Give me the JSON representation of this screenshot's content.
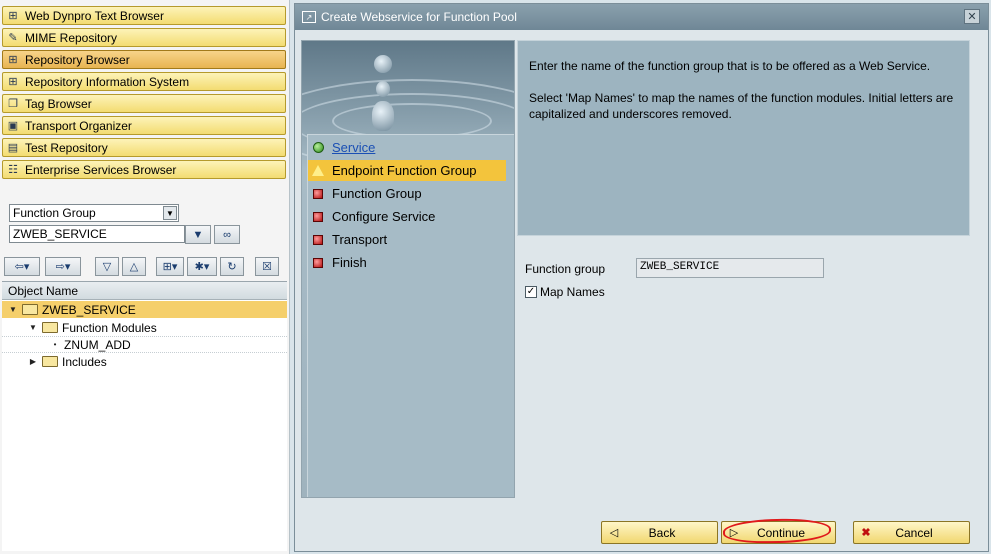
{
  "nav_buttons": [
    {
      "label": "Web Dynpro Text Browser",
      "icon": "hierarchy-icon",
      "active": false
    },
    {
      "label": "MIME Repository",
      "icon": "edit-icon",
      "active": false
    },
    {
      "label": "Repository Browser",
      "icon": "hierarchy-icon",
      "active": true
    },
    {
      "label": "Repository Information System",
      "icon": "hierarchy-icon",
      "active": false
    },
    {
      "label": "Tag Browser",
      "icon": "tag-icon",
      "active": false
    },
    {
      "label": "Transport Organizer",
      "icon": "truck-icon",
      "active": false
    },
    {
      "label": "Test Repository",
      "icon": "test-icon",
      "active": false
    },
    {
      "label": "Enterprise Services Browser",
      "icon": "services-icon",
      "active": false
    }
  ],
  "object_type_select": {
    "value": "Function Group"
  },
  "object_name_input": {
    "value": "ZWEB_SERVICE"
  },
  "tree": {
    "header": "Object Name",
    "rows": [
      {
        "label": "ZWEB_SERVICE",
        "toggle": "▼",
        "folder": true,
        "selected": true
      },
      {
        "label": "Function Modules",
        "toggle": "▼",
        "folder": true,
        "selected": false
      },
      {
        "label": "ZNUM_ADD",
        "toggle": "•",
        "folder": false,
        "selected": false
      },
      {
        "label": "Includes",
        "toggle": "▶",
        "folder": true,
        "selected": false
      }
    ]
  },
  "dialog": {
    "title": "Create Webservice for Function Pool",
    "steps": [
      {
        "label": "Service",
        "status": "done",
        "link": true
      },
      {
        "label": "Endpoint Function Group",
        "status": "current",
        "link": false
      },
      {
        "label": "Function Group",
        "status": "pending",
        "link": false
      },
      {
        "label": "Configure Service",
        "status": "pending",
        "link": false
      },
      {
        "label": "Transport",
        "status": "pending",
        "link": false
      },
      {
        "label": "Finish",
        "status": "pending",
        "link": false
      }
    ],
    "info_paragraphs": [
      "Enter the name of the function group that is to be offered as a Web Service.",
      "Select 'Map Names' to map the names of the function modules. Initial letters are capitalized and underscores removed."
    ],
    "form": {
      "function_group_label": "Function group",
      "function_group_value": "ZWEB_SERVICE",
      "map_names_label": "Map Names",
      "map_names_checked": true
    },
    "buttons": {
      "back": "Back",
      "continue": "Continue",
      "cancel": "Cancel"
    }
  },
  "colors": {
    "nav_button": "#f3dc72",
    "current_step": "#f3c43c",
    "annotation": "#e0191b",
    "title_bar": "#6f8796"
  }
}
